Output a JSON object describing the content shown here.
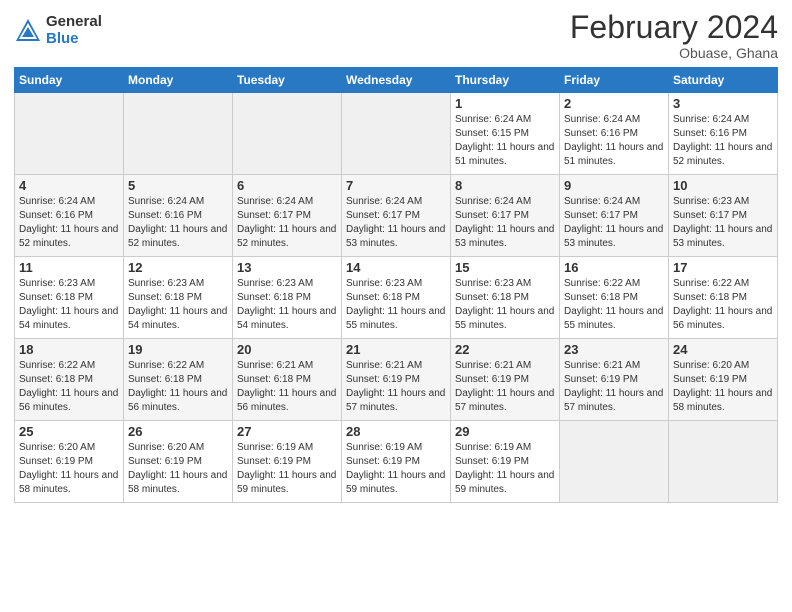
{
  "header": {
    "logo_general": "General",
    "logo_blue": "Blue",
    "month_title": "February 2024",
    "location": "Obuase, Ghana"
  },
  "days_of_week": [
    "Sunday",
    "Monday",
    "Tuesday",
    "Wednesday",
    "Thursday",
    "Friday",
    "Saturday"
  ],
  "weeks": [
    {
      "days": [
        {
          "number": "",
          "empty": true
        },
        {
          "number": "",
          "empty": true
        },
        {
          "number": "",
          "empty": true
        },
        {
          "number": "",
          "empty": true
        },
        {
          "number": "1",
          "sunrise": "6:24 AM",
          "sunset": "6:15 PM",
          "daylight": "11 hours and 51 minutes."
        },
        {
          "number": "2",
          "sunrise": "6:24 AM",
          "sunset": "6:16 PM",
          "daylight": "11 hours and 51 minutes."
        },
        {
          "number": "3",
          "sunrise": "6:24 AM",
          "sunset": "6:16 PM",
          "daylight": "11 hours and 52 minutes."
        }
      ]
    },
    {
      "days": [
        {
          "number": "4",
          "sunrise": "6:24 AM",
          "sunset": "6:16 PM",
          "daylight": "11 hours and 52 minutes."
        },
        {
          "number": "5",
          "sunrise": "6:24 AM",
          "sunset": "6:16 PM",
          "daylight": "11 hours and 52 minutes."
        },
        {
          "number": "6",
          "sunrise": "6:24 AM",
          "sunset": "6:17 PM",
          "daylight": "11 hours and 52 minutes."
        },
        {
          "number": "7",
          "sunrise": "6:24 AM",
          "sunset": "6:17 PM",
          "daylight": "11 hours and 53 minutes."
        },
        {
          "number": "8",
          "sunrise": "6:24 AM",
          "sunset": "6:17 PM",
          "daylight": "11 hours and 53 minutes."
        },
        {
          "number": "9",
          "sunrise": "6:24 AM",
          "sunset": "6:17 PM",
          "daylight": "11 hours and 53 minutes."
        },
        {
          "number": "10",
          "sunrise": "6:23 AM",
          "sunset": "6:17 PM",
          "daylight": "11 hours and 53 minutes."
        }
      ]
    },
    {
      "days": [
        {
          "number": "11",
          "sunrise": "6:23 AM",
          "sunset": "6:18 PM",
          "daylight": "11 hours and 54 minutes."
        },
        {
          "number": "12",
          "sunrise": "6:23 AM",
          "sunset": "6:18 PM",
          "daylight": "11 hours and 54 minutes."
        },
        {
          "number": "13",
          "sunrise": "6:23 AM",
          "sunset": "6:18 PM",
          "daylight": "11 hours and 54 minutes."
        },
        {
          "number": "14",
          "sunrise": "6:23 AM",
          "sunset": "6:18 PM",
          "daylight": "11 hours and 55 minutes."
        },
        {
          "number": "15",
          "sunrise": "6:23 AM",
          "sunset": "6:18 PM",
          "daylight": "11 hours and 55 minutes."
        },
        {
          "number": "16",
          "sunrise": "6:22 AM",
          "sunset": "6:18 PM",
          "daylight": "11 hours and 55 minutes."
        },
        {
          "number": "17",
          "sunrise": "6:22 AM",
          "sunset": "6:18 PM",
          "daylight": "11 hours and 56 minutes."
        }
      ]
    },
    {
      "days": [
        {
          "number": "18",
          "sunrise": "6:22 AM",
          "sunset": "6:18 PM",
          "daylight": "11 hours and 56 minutes."
        },
        {
          "number": "19",
          "sunrise": "6:22 AM",
          "sunset": "6:18 PM",
          "daylight": "11 hours and 56 minutes."
        },
        {
          "number": "20",
          "sunrise": "6:21 AM",
          "sunset": "6:18 PM",
          "daylight": "11 hours and 56 minutes."
        },
        {
          "number": "21",
          "sunrise": "6:21 AM",
          "sunset": "6:19 PM",
          "daylight": "11 hours and 57 minutes."
        },
        {
          "number": "22",
          "sunrise": "6:21 AM",
          "sunset": "6:19 PM",
          "daylight": "11 hours and 57 minutes."
        },
        {
          "number": "23",
          "sunrise": "6:21 AM",
          "sunset": "6:19 PM",
          "daylight": "11 hours and 57 minutes."
        },
        {
          "number": "24",
          "sunrise": "6:20 AM",
          "sunset": "6:19 PM",
          "daylight": "11 hours and 58 minutes."
        }
      ]
    },
    {
      "days": [
        {
          "number": "25",
          "sunrise": "6:20 AM",
          "sunset": "6:19 PM",
          "daylight": "11 hours and 58 minutes."
        },
        {
          "number": "26",
          "sunrise": "6:20 AM",
          "sunset": "6:19 PM",
          "daylight": "11 hours and 58 minutes."
        },
        {
          "number": "27",
          "sunrise": "6:19 AM",
          "sunset": "6:19 PM",
          "daylight": "11 hours and 59 minutes."
        },
        {
          "number": "28",
          "sunrise": "6:19 AM",
          "sunset": "6:19 PM",
          "daylight": "11 hours and 59 minutes."
        },
        {
          "number": "29",
          "sunrise": "6:19 AM",
          "sunset": "6:19 PM",
          "daylight": "11 hours and 59 minutes."
        },
        {
          "number": "",
          "empty": true
        },
        {
          "number": "",
          "empty": true
        }
      ]
    }
  ]
}
